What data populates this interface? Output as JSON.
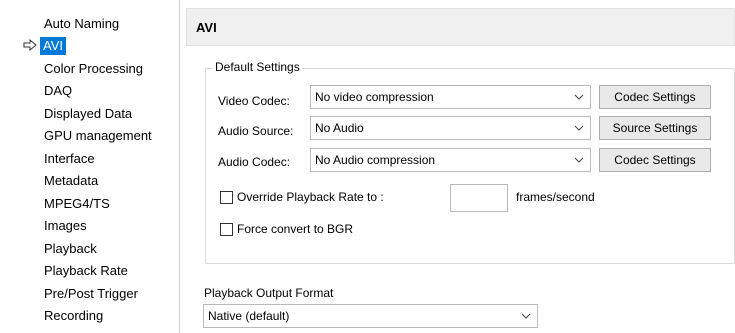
{
  "sidebar": {
    "selected_marker_icon": "arrow-right-icon",
    "items": [
      {
        "label": "Auto Naming"
      },
      {
        "label": "AVI",
        "selected": true
      },
      {
        "label": "Color Processing"
      },
      {
        "label": "DAQ"
      },
      {
        "label": "Displayed Data"
      },
      {
        "label": "GPU management"
      },
      {
        "label": "Interface"
      },
      {
        "label": "Metadata"
      },
      {
        "label": "MPEG4/TS"
      },
      {
        "label": "Images"
      },
      {
        "label": "Playback"
      },
      {
        "label": "Playback Rate"
      },
      {
        "label": "Pre/Post Trigger"
      },
      {
        "label": "Recording"
      }
    ]
  },
  "header": {
    "title": "AVI"
  },
  "default_settings": {
    "title": "Default Settings",
    "video_codec": {
      "label": "Video Codec:",
      "value": "No video compression",
      "button": "Codec Settings"
    },
    "audio_source": {
      "label": "Audio Source:",
      "value": "No Audio",
      "button": "Source Settings"
    },
    "audio_codec": {
      "label": "Audio Codec:",
      "value": "No Audio compression",
      "button": "Codec Settings"
    },
    "override_rate": {
      "label": "Override Playback Rate to :",
      "checked": false,
      "value": "",
      "unit": "frames/second"
    },
    "force_bgr": {
      "label": "Force convert to BGR",
      "checked": false
    }
  },
  "playback_output": {
    "label": "Playback Output Format",
    "value": "Native (default)"
  },
  "colors": {
    "selection": "#0078d7",
    "header_bg": "#f0f0f0",
    "button_bg": "#e9e9e9"
  }
}
